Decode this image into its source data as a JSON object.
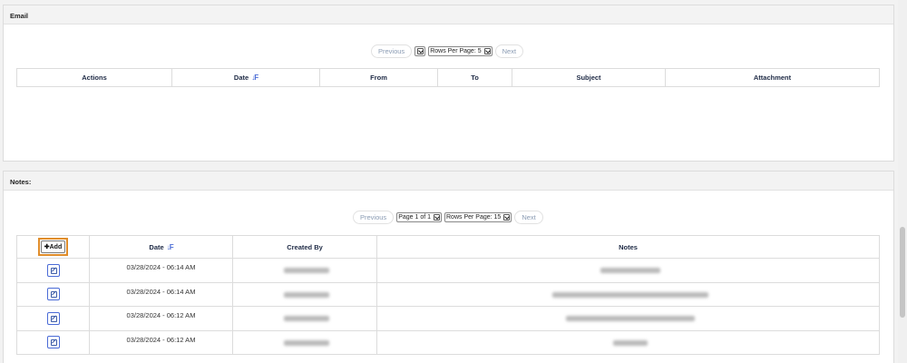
{
  "email": {
    "title": "Email",
    "pager": {
      "previous": "Previous",
      "rows_per_page": "Rows Per Page: 5",
      "next": "Next"
    },
    "columns": [
      "Actions",
      "Date",
      "From",
      "To",
      "Subject",
      "Attachment"
    ]
  },
  "notes": {
    "title": "Notes:",
    "pager": {
      "previous": "Previous",
      "page": "Page 1 of 1",
      "rows_per_page": "Rows Per Page: 15",
      "next": "Next"
    },
    "add_label": "Add",
    "columns": [
      "Date",
      "Created By",
      "Notes"
    ],
    "rows": [
      {
        "date": "03/28/2024 - 06:14 AM"
      },
      {
        "date": "03/28/2024 - 06:14 AM"
      },
      {
        "date": "03/28/2024 - 06:12 AM"
      },
      {
        "date": "03/28/2024 - 06:12 AM"
      }
    ]
  }
}
